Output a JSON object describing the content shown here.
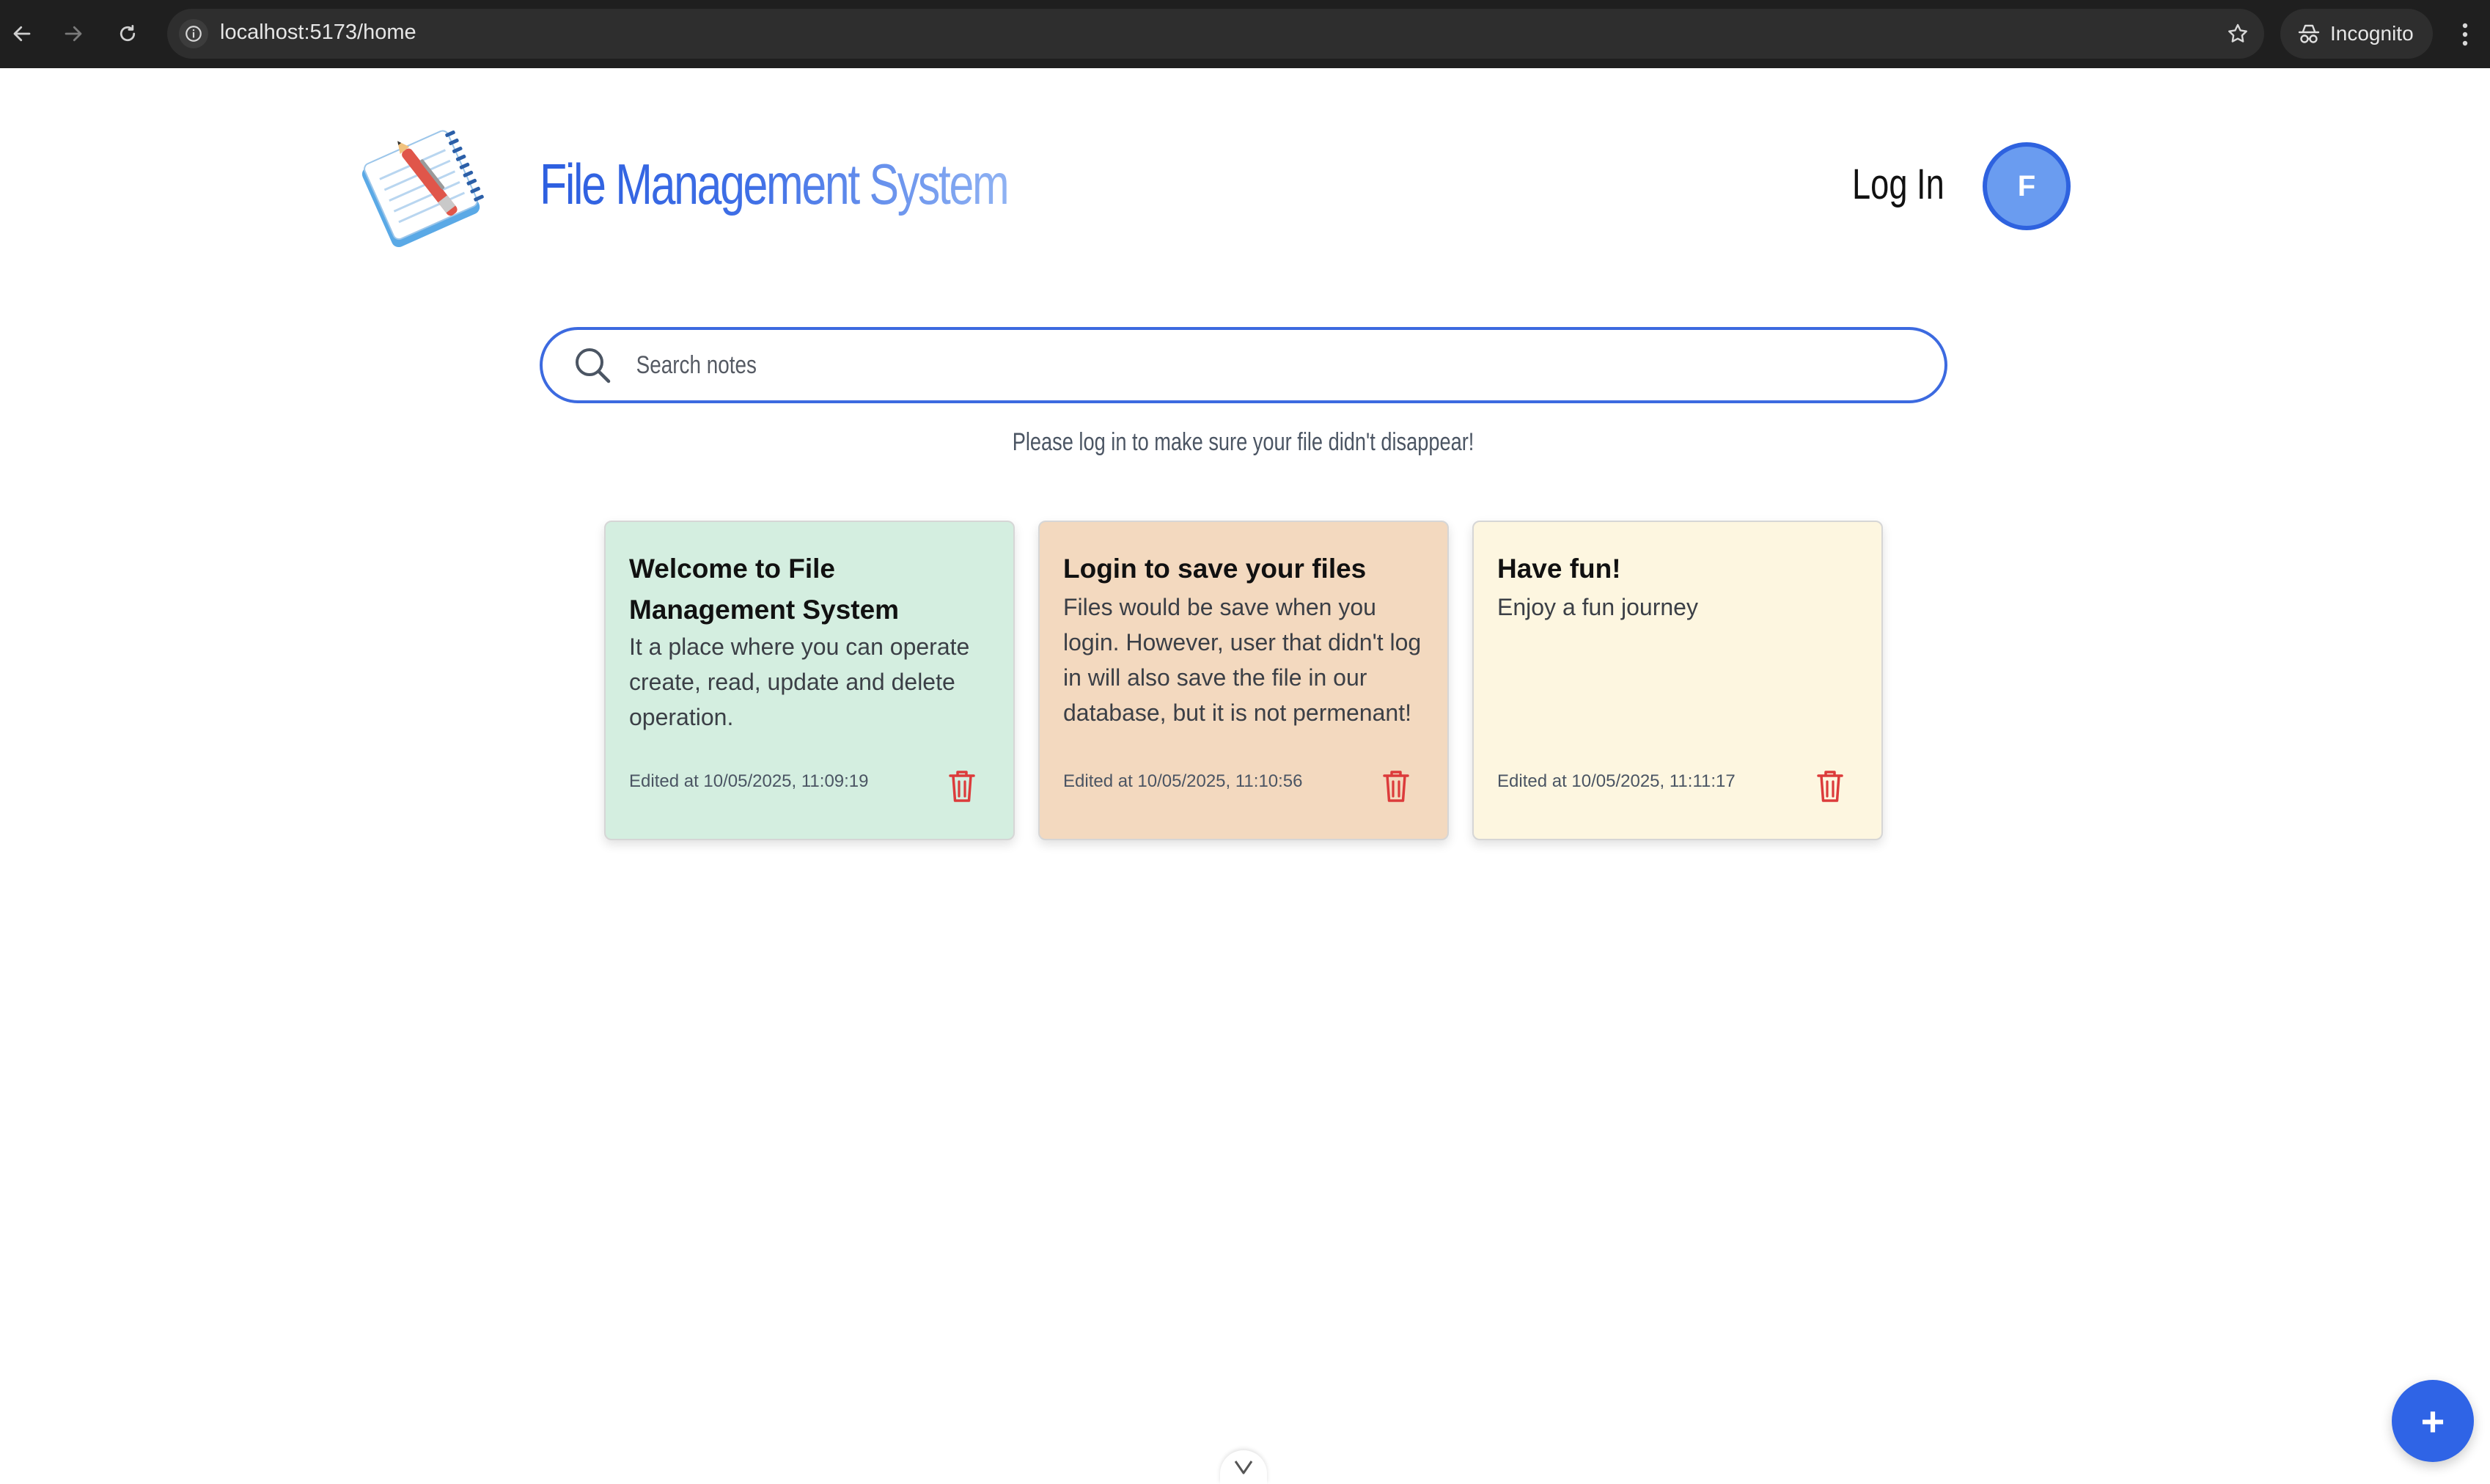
{
  "browser": {
    "url": "localhost:5173/home",
    "incognito_label": "Incognito",
    "icons": [
      "back-icon",
      "forward-icon",
      "reload-icon",
      "site-info-icon",
      "bookmark-star-icon",
      "incognito-icon",
      "kebab-menu-icon"
    ]
  },
  "header": {
    "title": "File Management System",
    "login_label": "Log In",
    "avatar_initial": "F",
    "logo_icon": "notepad-with-pen-icon"
  },
  "search": {
    "placeholder": "Search notes",
    "value": ""
  },
  "login_hint": "Please log in to make sure your file didn't disappear!",
  "notes": [
    {
      "title": "Welcome to File Management System",
      "body": "It a place where you can operate create, read, update and delete operation.",
      "edited": "Edited at 10/05/2025, 11:09:19",
      "color": "#d4eee0"
    },
    {
      "title": "Login to save your files",
      "body": "Files would be save when you login. However, user that didn't log in will also save the file in our database, but it is not permenant!",
      "edited": "Edited at 10/05/2025, 11:10:56",
      "color": "#f3d9bf"
    },
    {
      "title": "Have fun!",
      "body": "Enjoy a fun journey",
      "edited": "Edited at 10/05/2025, 11:11:17",
      "color": "#fdf6e0"
    }
  ],
  "fab_label": "+",
  "colors": {
    "accent": "#2f64e6",
    "trash": "#dc3b3b"
  }
}
